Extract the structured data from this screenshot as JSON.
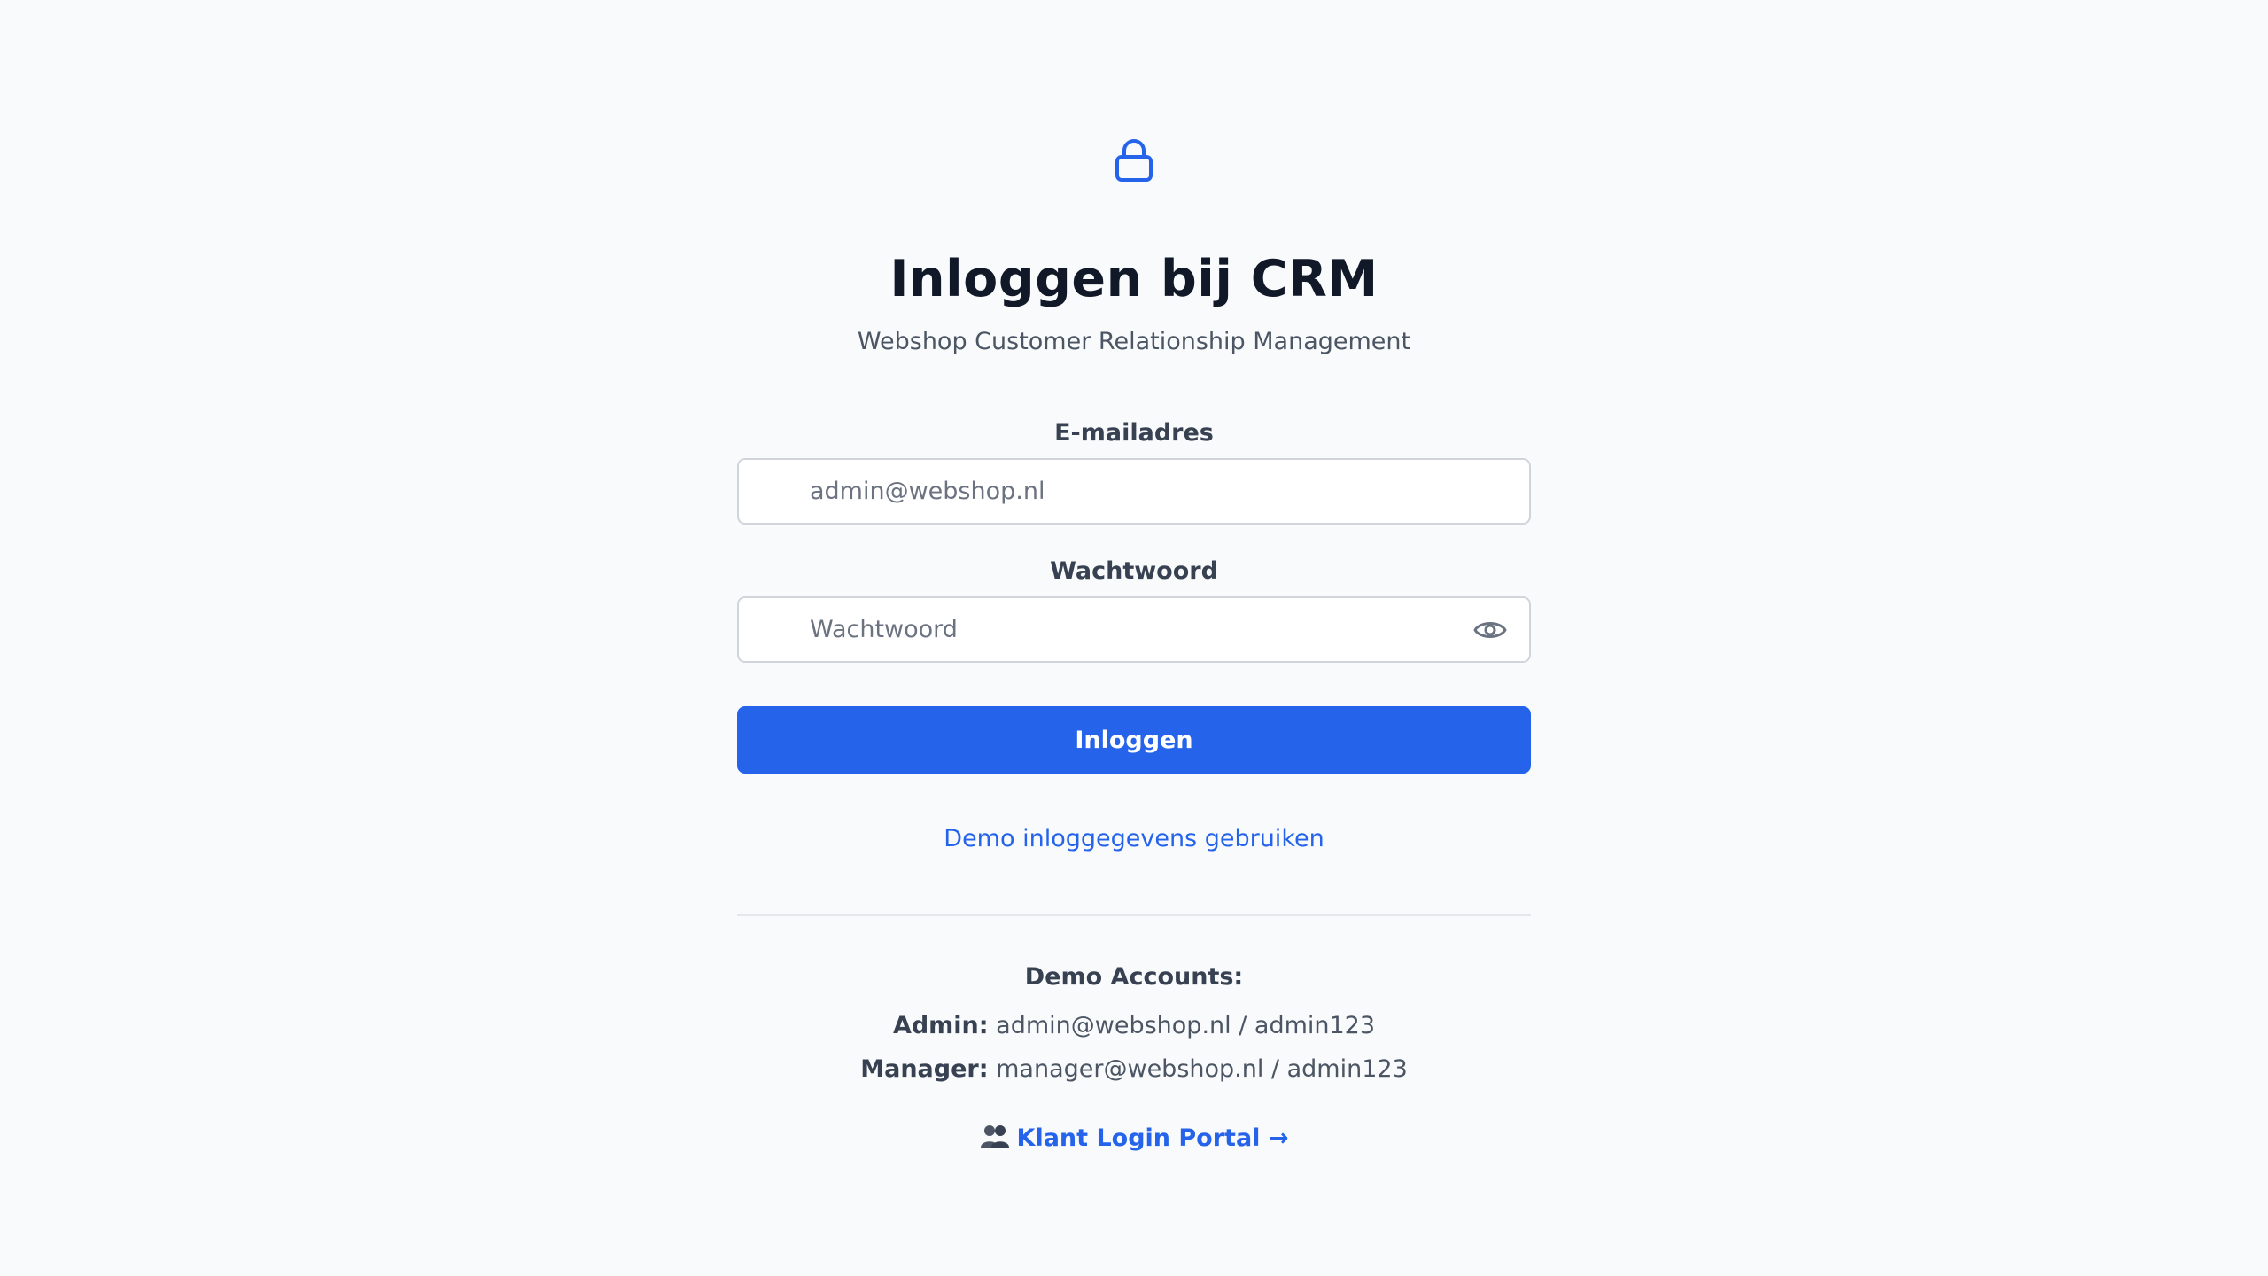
{
  "header": {
    "lock_icon": "lock-icon",
    "title": "Inloggen bij CRM",
    "subtitle": "Webshop Customer Relationship Management"
  },
  "form": {
    "email_label": "E-mailadres",
    "email_placeholder": "admin@webshop.nl",
    "email_value": "",
    "password_label": "Wachtwoord",
    "password_placeholder": "Wachtwoord",
    "password_value": "",
    "toggle_icon": "eye-icon",
    "submit_label": "Inloggen",
    "demo_link": "Demo inloggegevens gebruiken"
  },
  "demo_accounts": {
    "heading": "Demo Accounts:",
    "accounts": [
      {
        "role": "Admin:",
        "credentials": "admin@webshop.nl / admin123"
      },
      {
        "role": "Manager:",
        "credentials": "manager@webshop.nl / admin123"
      }
    ]
  },
  "footer": {
    "portal_icon": "people-icon",
    "portal_link": "Klant Login Portal →"
  },
  "colors": {
    "background": "#f8fafc",
    "accent": "#2563eb",
    "text": "#111827",
    "muted": "#4b5563",
    "border": "#d1d5db"
  }
}
